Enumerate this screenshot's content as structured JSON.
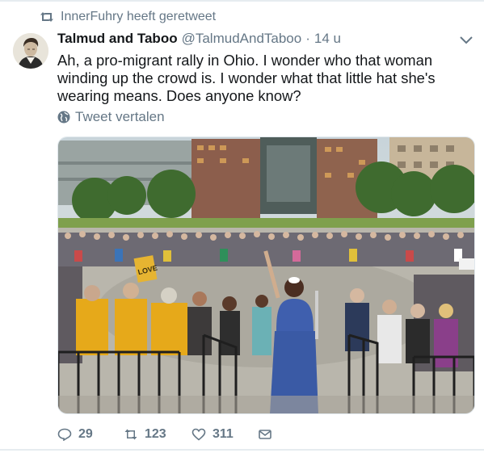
{
  "retweet_context": {
    "icon": "retweet-icon",
    "text": "InnerFuhry heeft geretweet"
  },
  "tweet": {
    "author": {
      "name": "Talmud and Taboo",
      "handle": "@TalmudAndTaboo",
      "separator": "·",
      "timestamp": "14 u",
      "avatar_icon": "portrait-avatar"
    },
    "menu_icon": "chevron-down-icon",
    "text": "Ah, a pro-migrant rally in Ohio. I wonder who that woman winding up the crowd is. I wonder what that little hat she's wearing means. Does anyone know?",
    "translate": {
      "icon": "globe-icon",
      "label": "Tweet vertalen"
    },
    "media": {
      "sign_text": "LOVE"
    },
    "actions": {
      "reply_count": "29",
      "retweet_count": "123",
      "like_count": "311",
      "reply_icon": "reply-icon",
      "retweet_icon": "retweet-icon",
      "like_icon": "heart-icon",
      "dm_icon": "envelope-icon"
    }
  },
  "colors": {
    "text": "#14171a",
    "muted": "#657786",
    "border": "#e6ecf0"
  }
}
